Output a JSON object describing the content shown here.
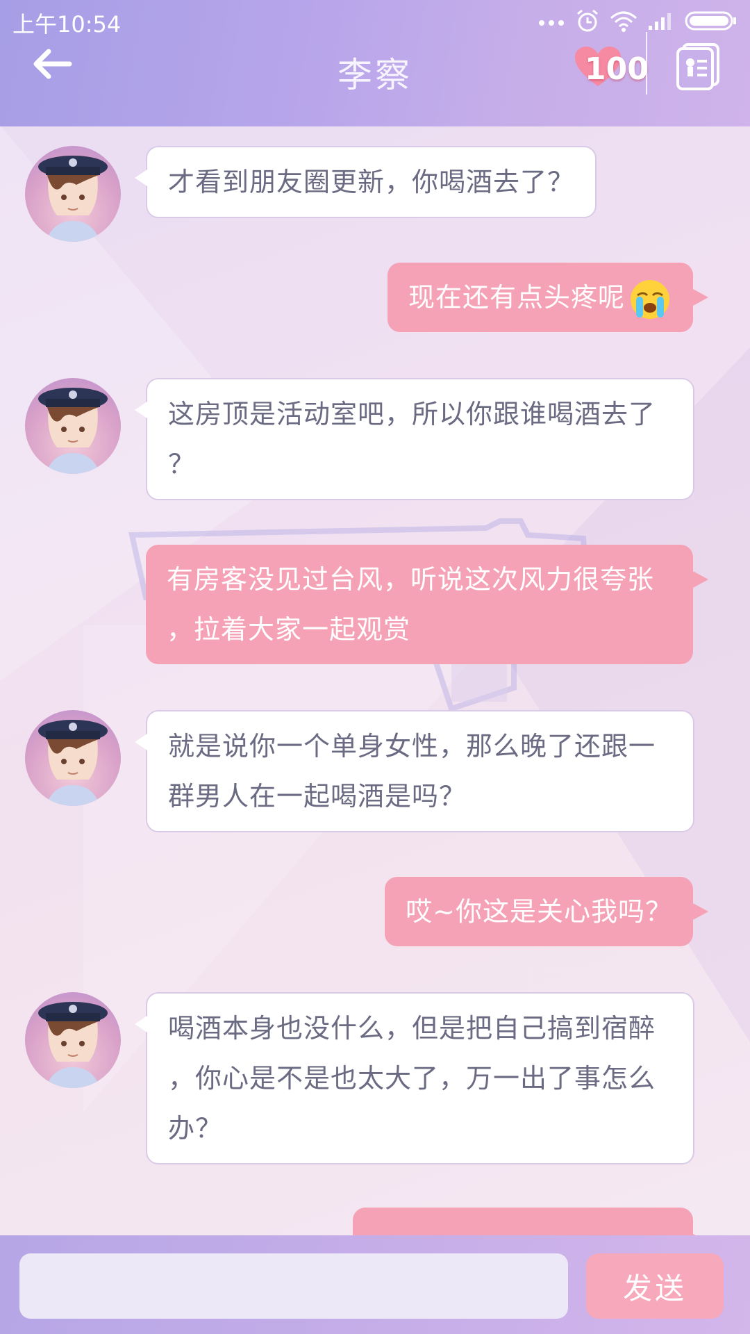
{
  "status_bar": {
    "time": "上午10:54"
  },
  "header": {
    "title": "李察",
    "affection_score": "100"
  },
  "messages": [
    {
      "from": "contact",
      "text": "才看到朋友圈更新，你喝酒去了？"
    },
    {
      "from": "me",
      "text": "现在还有点头疼呢",
      "emoji": "crying-face"
    },
    {
      "from": "contact",
      "lines": [
        "这房顶是活动室吧，所以你跟谁喝酒去了",
        "？"
      ]
    },
    {
      "from": "me",
      "lines": [
        "有房客没见过台风，听说这次风力很夸张",
        "，拉着大家一起观赏"
      ]
    },
    {
      "from": "contact",
      "lines": [
        "就是说你一个单身女性，那么晚了还跟一",
        "群男人在一起喝酒是吗？"
      ]
    },
    {
      "from": "me",
      "text": "哎~你这是关心我吗？"
    },
    {
      "from": "contact",
      "lines": [
        "喝酒本身也没什么，但是把自己搞到宿醉",
        "，你心是不是也太大了，万一出了事怎么",
        "办？"
      ]
    }
  ],
  "input": {
    "value": "",
    "send_label": "发送"
  },
  "colors": {
    "header": "#b7a5ea",
    "outgoing_bubble": "#f6a2b6",
    "incoming_bubble": "#ffffff",
    "send_button": "#f7a9bb"
  }
}
